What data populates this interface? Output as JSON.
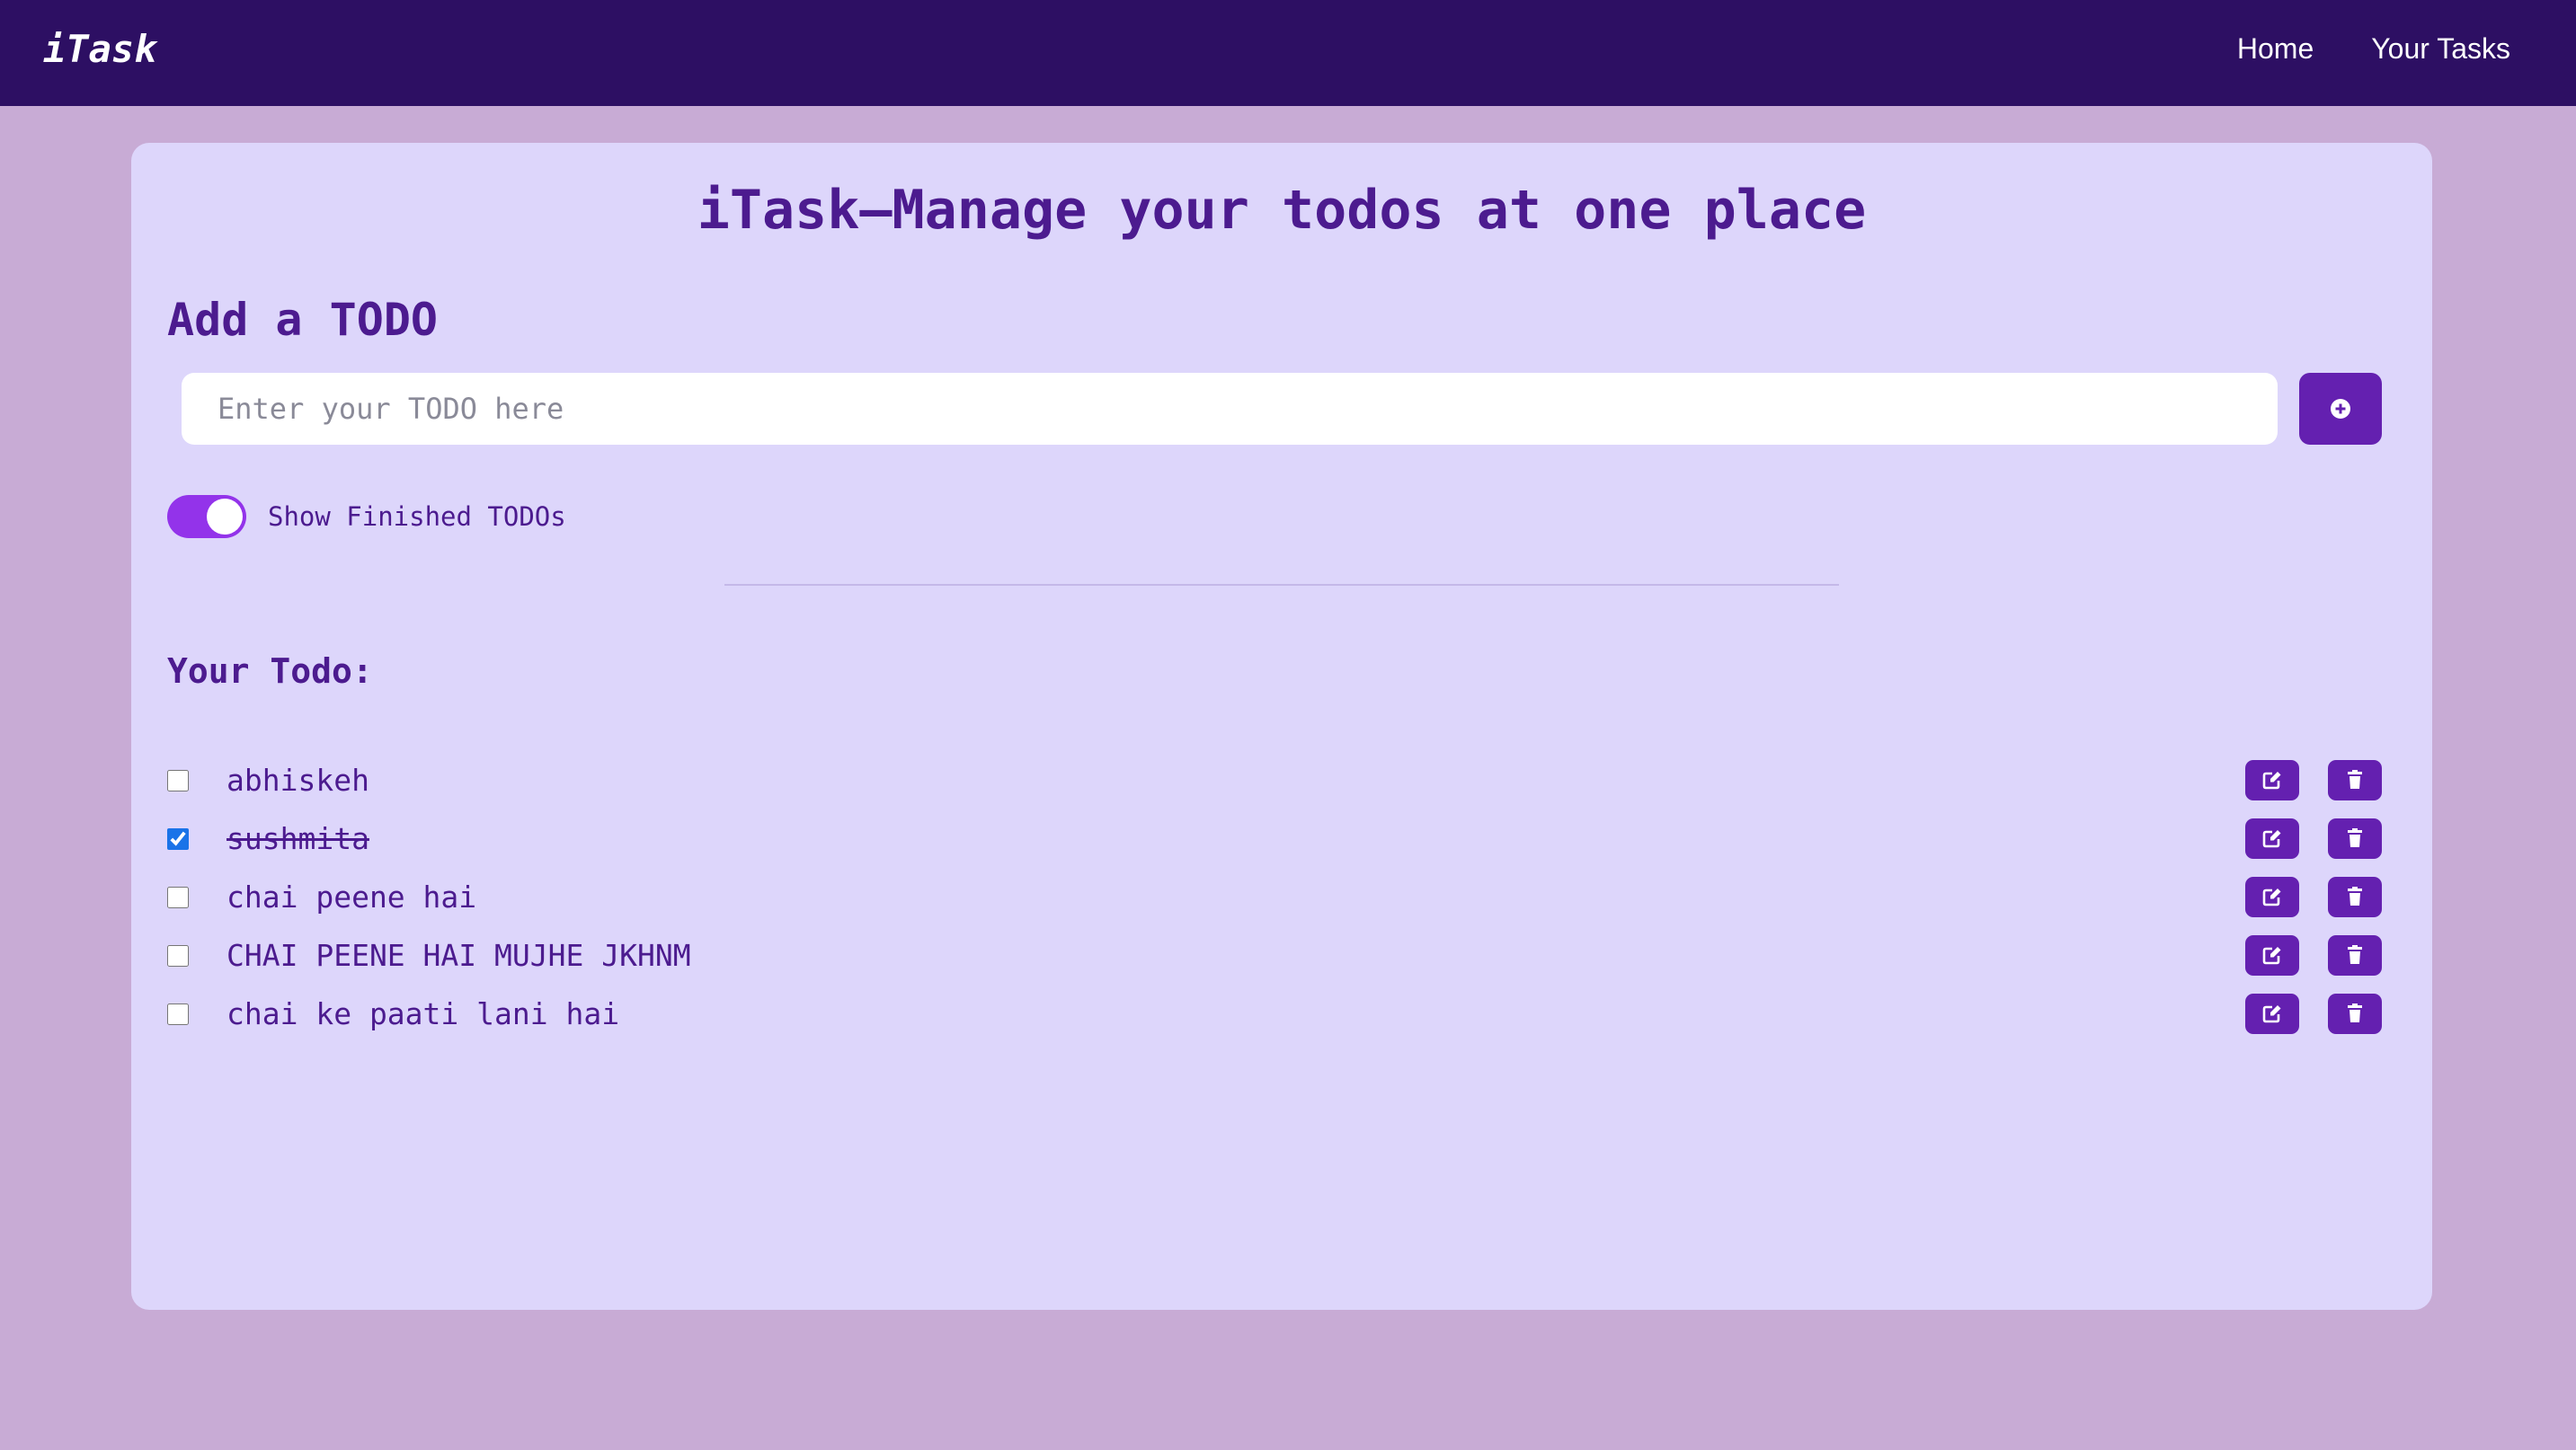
{
  "navbar": {
    "brand": "iTask",
    "links": [
      "Home",
      "Your Tasks"
    ]
  },
  "main": {
    "title": "iTask—Manage your todos at one place",
    "add_section_title": "Add a TODO",
    "input": {
      "placeholder": "Enter your TODO here",
      "value": ""
    },
    "add_button_icon": "plus-circle-icon",
    "show_finished": {
      "label": "Show Finished TODOs",
      "enabled": true
    },
    "todos_title": "Your Todo:",
    "todos": [
      {
        "text": "abhiskeh",
        "completed": false
      },
      {
        "text": "sushmita",
        "completed": true
      },
      {
        "text": "chai peene hai",
        "completed": false
      },
      {
        "text": "CHAI PEENE HAI MUJHE JKHNM",
        "completed": false
      },
      {
        "text": "chai ke paati lani hai",
        "completed": false
      }
    ],
    "edit_icon": "edit-icon",
    "delete_icon": "trash-icon"
  },
  "colors": {
    "page_background": "#c8abd5",
    "navbar_background": "#2d0f63",
    "card_background": "#ddd6fb",
    "accent": "#6420b0",
    "toggle": "#9333ea",
    "text": "#4c1b8f"
  }
}
